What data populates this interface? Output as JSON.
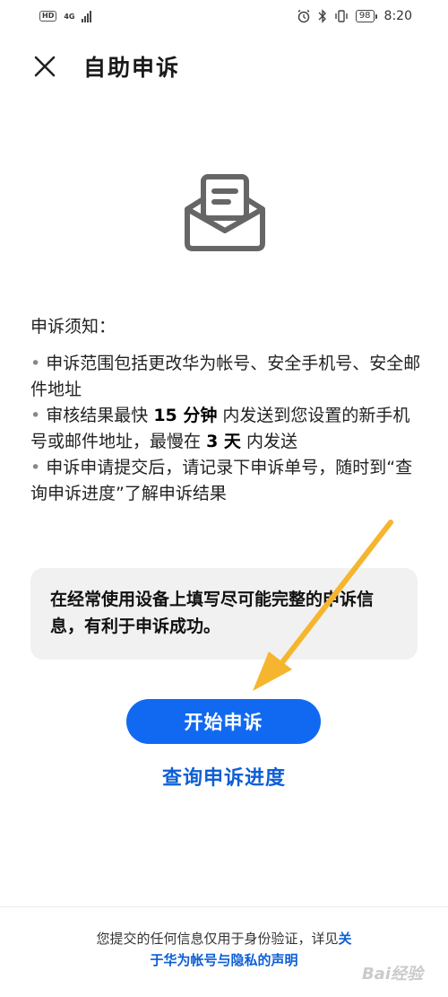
{
  "status_bar": {
    "hd": "HD",
    "network": "4G",
    "battery": "98",
    "time": "8:20"
  },
  "header": {
    "title": "自助申诉"
  },
  "notice": {
    "title": "申诉须知：",
    "item1": "申诉范围包括更改华为帐号、安全手机号、安全邮件地址",
    "item2_a": "审核结果最快",
    "item2_b": "15 分钟",
    "item2_c": "内发送到您设置的新手机号或邮件地址，最慢在",
    "item2_d": "3 天",
    "item2_e": "内发送",
    "item3": "申诉申请提交后，请记录下申诉单号，随时到“查询申诉进度”了解申诉结果"
  },
  "tip": "在经常使用设备上填写尽可能完整的申诉信息，有利于申诉成功。",
  "start_button": "开始申诉",
  "progress_link": "查询申诉进度",
  "footer": {
    "text": "您提交的任何信息仅用于身份验证，详见",
    "link": "关于华为帐号与隐私的声明"
  },
  "watermark": "Bai经验",
  "colors": {
    "primary": "#1169f2",
    "link": "#0d5fd6",
    "arrow": "#f5b52e",
    "tip_bg": "#f1f1f1"
  }
}
